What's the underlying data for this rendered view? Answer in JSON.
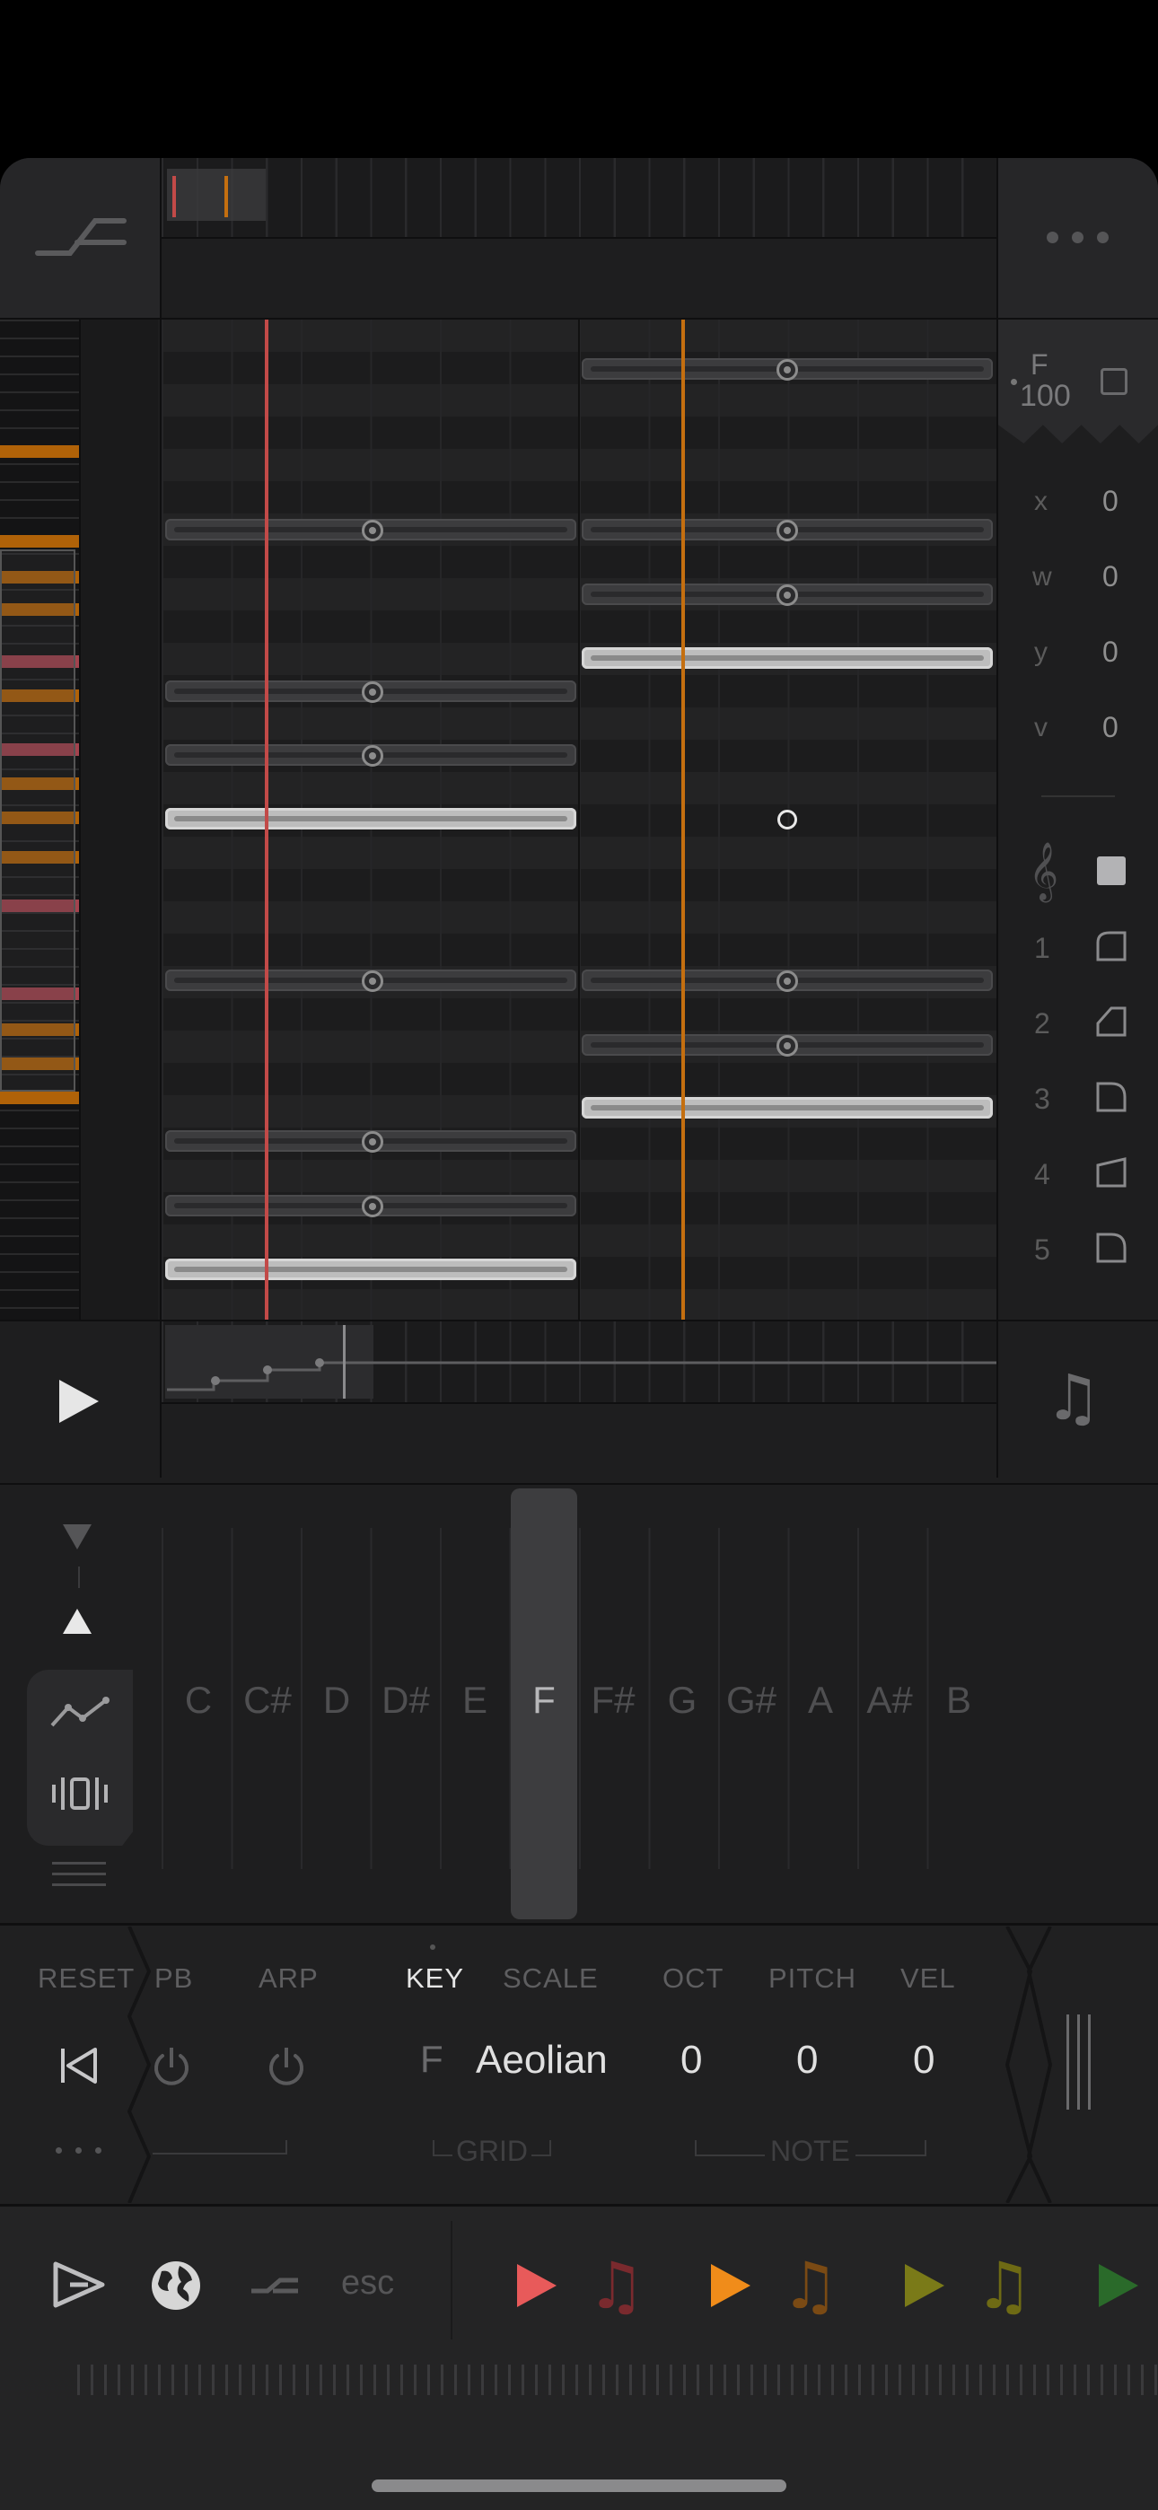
{
  "inspector": {
    "key_note": "F",
    "key_velocity": "100",
    "fields": [
      {
        "label": "x",
        "value": "0"
      },
      {
        "label": "w",
        "value": "0"
      },
      {
        "label": "y",
        "value": "0"
      },
      {
        "label": "v",
        "value": "0"
      }
    ],
    "channels": [
      "1",
      "2",
      "3",
      "4",
      "5"
    ]
  },
  "keyboard": {
    "notes": [
      "C",
      "C#",
      "D",
      "D#",
      "E",
      "F",
      "F#",
      "G",
      "G#",
      "A",
      "A#",
      "B"
    ],
    "selected": "F"
  },
  "controls": {
    "reset_label": "RESET",
    "pb_label": "PB",
    "arp_label": "ARP",
    "key_label": "KEY",
    "scale_label": "SCALE",
    "oct_label": "OCT",
    "pitch_label": "PITCH",
    "vel_label": "VEL",
    "key_value": "F",
    "scale_value": "Aeolian",
    "oct_value": "0",
    "pitch_value": "0",
    "vel_value": "0",
    "grid_label": "GRID",
    "note_label": "NOTE"
  },
  "dock": {
    "esc_label": "esc",
    "colors": {
      "track1": "#e85a5a",
      "track2": "#f08c1a",
      "track3": "#7a7a18",
      "track4": "#2a6a2a"
    }
  },
  "colors": {
    "playhead_red": "#c24a48",
    "playhead_orange": "#c46f10",
    "note_bright": "#bdbdbd"
  }
}
